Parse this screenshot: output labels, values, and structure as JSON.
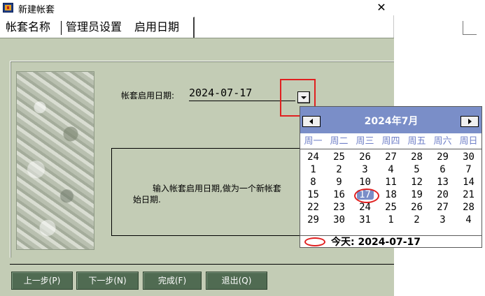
{
  "window": {
    "title": "新建帐套",
    "close_glyph": "✕"
  },
  "tabs": [
    {
      "label": "帐套名称"
    },
    {
      "label": "管理员设置"
    },
    {
      "label": "启用日期"
    }
  ],
  "form": {
    "label": "帐套启用日期:",
    "value": "2024-07-17"
  },
  "info": {
    "line1": "输入帐套启用日期,做为一个新帐套",
    "line2": "始日期."
  },
  "buttons": {
    "prev": "上一步(P)",
    "next": "下一步(N)",
    "finish": "完成(F)",
    "exit": "退出(Q)"
  },
  "calendar": {
    "title": "2024年7月",
    "weekdays": [
      "周一",
      "周二",
      "周三",
      "周四",
      "周五",
      "周六",
      "周日"
    ],
    "weeks": [
      [
        "24",
        "25",
        "26",
        "27",
        "28",
        "29",
        "30"
      ],
      [
        "1",
        "2",
        "3",
        "4",
        "5",
        "6",
        "7"
      ],
      [
        "8",
        "9",
        "10",
        "11",
        "12",
        "13",
        "14"
      ],
      [
        "15",
        "16",
        "17",
        "18",
        "19",
        "20",
        "21"
      ],
      [
        "22",
        "23",
        "24",
        "25",
        "26",
        "27",
        "28"
      ],
      [
        "29",
        "30",
        "31",
        "1",
        "2",
        "3",
        "4"
      ]
    ],
    "selected_day": "17",
    "today_text": "今天: 2024-07-17",
    "colors": {
      "header": "#7a8ec8",
      "annotation": "#e02020"
    }
  }
}
